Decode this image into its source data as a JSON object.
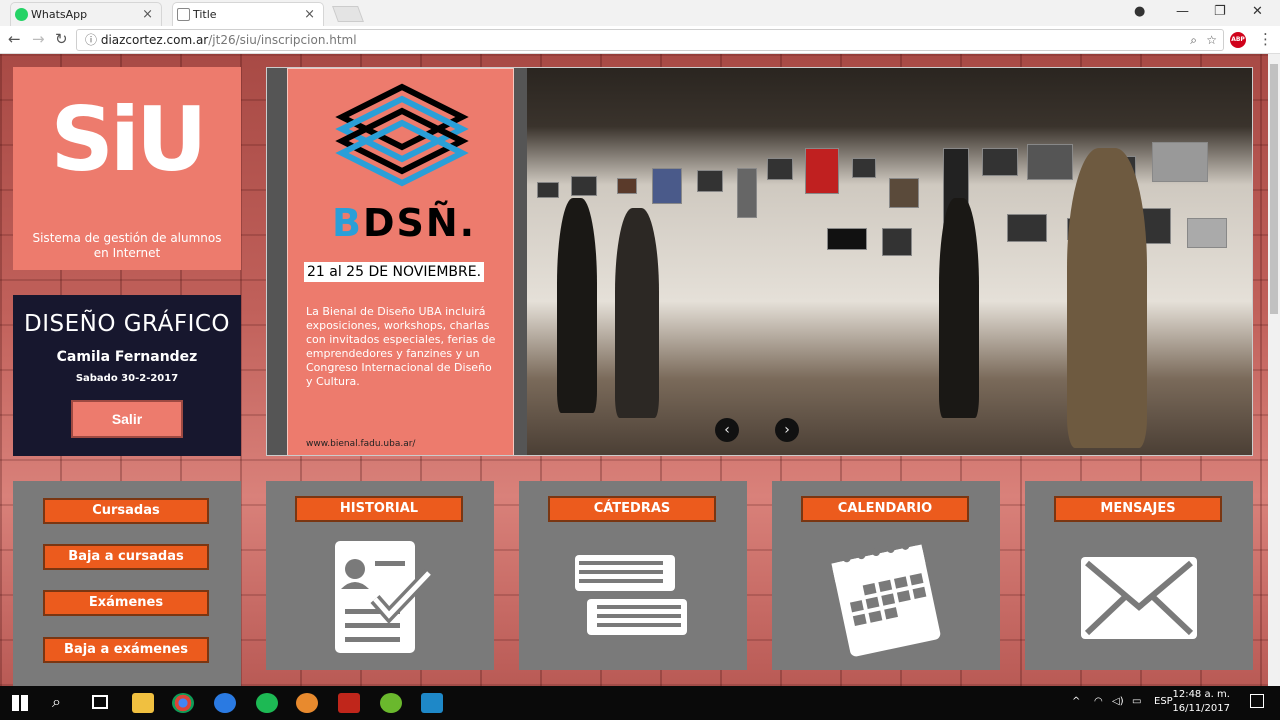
{
  "browser": {
    "tabs": [
      {
        "label": "WhatsApp",
        "close": "×"
      },
      {
        "label": "Title",
        "close": "×"
      }
    ],
    "url_domain": "diazcortez.com.ar",
    "url_path": "/jt26/siu/inscripcion.html",
    "ext_badge": "ABP"
  },
  "sidebar": {
    "logo": "SiU",
    "tagline": "Sistema de gestión de alumnos en Internet",
    "career": "DISEÑO GRÁFICO",
    "user_name": "Camila Fernandez",
    "date": "Sabado 30-2-2017",
    "logout": "Salir"
  },
  "slider": {
    "poster_title_b": "B",
    "poster_title_rest": "DSÑ.",
    "poster_date": "21 al 25 DE NOVIEMBRE.",
    "poster_desc": "La Bienal de Diseño UBA incluirá exposiciones, workshops, charlas con invitados especiales, ferias de emprendedores y fanzines y un Congreso Internacional de Diseño y Cultura.",
    "poster_url": "www.bienal.fadu.uba.ar/",
    "prev": "‹",
    "next": "›"
  },
  "menu": {
    "items": [
      "Cursadas",
      "Baja a cursadas",
      "Exámenes",
      "Baja a exámenes"
    ]
  },
  "cards": [
    {
      "title": "HISTORIAL",
      "icon": "document-check-icon"
    },
    {
      "title": "CÁTEDRAS",
      "icon": "books-icon"
    },
    {
      "title": "CALENDARIO",
      "icon": "calendar-icon"
    },
    {
      "title": "MENSAJES",
      "icon": "envelope-icon"
    }
  ],
  "taskbar": {
    "lang": "ESP",
    "time": "12:48 a. m.",
    "date": "16/11/2017"
  },
  "colors": {
    "accent": "#ec5b1d",
    "salmon": "#ed7b6d",
    "navy": "#17172e",
    "card": "#7a7a7a"
  }
}
